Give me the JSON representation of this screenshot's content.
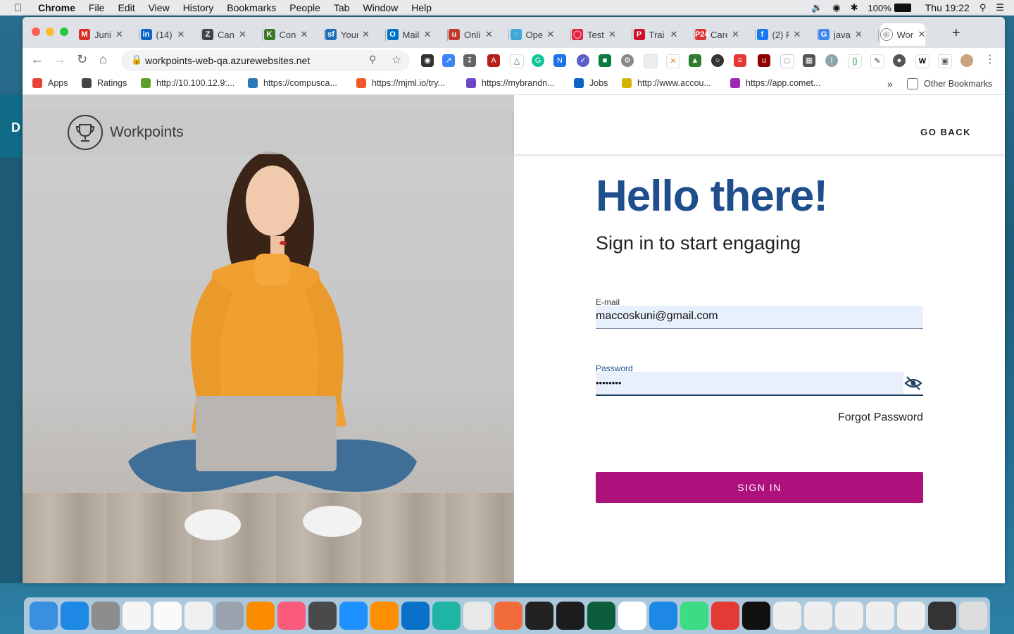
{
  "menubar": {
    "app": "Chrome",
    "items": [
      "File",
      "Edit",
      "View",
      "History",
      "Bookmarks",
      "People",
      "Tab",
      "Window",
      "Help"
    ],
    "battery": "100%",
    "clock": "Thu 19:22"
  },
  "background_app_letter": "D",
  "tabs": [
    {
      "label": "Juni",
      "color": "#d93025",
      "glyph": "M"
    },
    {
      "label": "(14)",
      "color": "#0a66c2",
      "glyph": "in"
    },
    {
      "label": "Can",
      "color": "#444",
      "glyph": "Z"
    },
    {
      "label": "Con",
      "color": "#3c7a2a",
      "glyph": "K"
    },
    {
      "label": "Your",
      "color": "#1d6fb8",
      "glyph": "sf"
    },
    {
      "label": "Mail",
      "color": "#0072c6",
      "glyph": "O"
    },
    {
      "label": "Onli",
      "color": "#c0392b",
      "glyph": "u"
    },
    {
      "label": "Ope",
      "color": "#3fa7d6",
      "glyph": "◌"
    },
    {
      "label": "Test",
      "color": "#e0223b",
      "glyph": "◯"
    },
    {
      "label": "Trai",
      "color": "#d00f2b",
      "glyph": "P"
    },
    {
      "label": "Care",
      "color": "#d33",
      "glyph": "P24"
    },
    {
      "label": "(2) F",
      "color": "#1877f2",
      "glyph": "f"
    },
    {
      "label": "java",
      "color": "#4285f4",
      "glyph": "G"
    },
    {
      "label": "Wor",
      "color": "#666",
      "glyph": "◎"
    }
  ],
  "address_bar": {
    "url": "workpoints-web-qa.azurewebsites.net"
  },
  "bookmarks": [
    {
      "label": "Apps",
      "color": "#e94235"
    },
    {
      "label": "Ratings",
      "color": "#444"
    },
    {
      "label": "http://10.100.12.9:...",
      "color": "#5aa02c"
    },
    {
      "label": "https://compusca...",
      "color": "#2a7ab8"
    },
    {
      "label": "https://mjml.io/try...",
      "color": "#f05a28"
    },
    {
      "label": "https://mybrandn...",
      "color": "#6b47c6"
    },
    {
      "label": "Jobs",
      "color": "#0a66c2"
    },
    {
      "label": "http://www.accou...",
      "color": "#d4b400"
    },
    {
      "label": "https://app.comet...",
      "color": "#9c27b0"
    }
  ],
  "bookmarks_overflow": "»",
  "other_bookmarks": "Other Bookmarks",
  "page": {
    "brand": "Workpoints",
    "go_back": "GO BACK",
    "heading": "Hello there!",
    "subheading": "Sign in to start engaging",
    "email_label": "E-mail",
    "email_value": "maccoskuni@gmail.com",
    "password_label": "Password",
    "password_value": "••••••••",
    "forgot": "Forgot Password",
    "signin": "SIGN IN"
  },
  "colors": {
    "heading": "#1f4e8c",
    "button": "#ad117b",
    "field_bg": "#e8f0fe",
    "password_label": "#1f4e8c"
  }
}
